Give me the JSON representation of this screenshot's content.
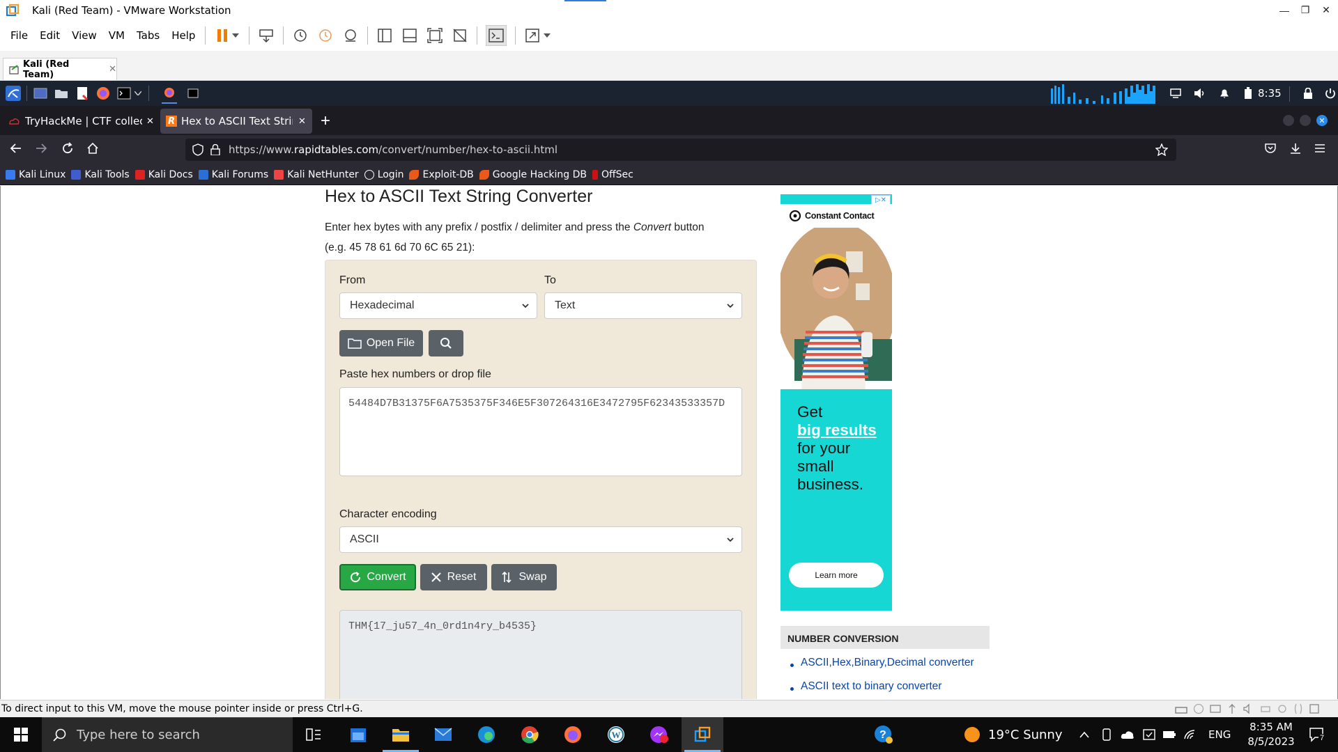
{
  "window": {
    "title": "Kali (Red Team) - VMware Workstation"
  },
  "menu": [
    "File",
    "Edit",
    "View",
    "VM",
    "Tabs",
    "Help"
  ],
  "vm_tab": {
    "label": "Kali (Red Team)"
  },
  "kali_panel": {
    "time": "8:35"
  },
  "browser": {
    "tabs": [
      {
        "label": "TryHackMe | CTF collectio",
        "active": false
      },
      {
        "label": "Hex to ASCII Text String C",
        "active": true
      }
    ],
    "url_prefix": "https://www.",
    "url_domain": "rapidtables.com",
    "url_path": "/convert/number/hex-to-ascii.html",
    "bookmarks": [
      "Kali Linux",
      "Kali Tools",
      "Kali Docs",
      "Kali Forums",
      "Kali NetHunter",
      "Login",
      "Exploit-DB",
      "Google Hacking DB",
      "OffSec"
    ]
  },
  "page": {
    "title": "Hex to ASCII Text String Converter",
    "desc_pre": "Enter hex bytes with any prefix / postfix / delimiter and press the ",
    "desc_em": "Convert",
    "desc_post": " button",
    "desc_example": "(e.g. 45 78 61 6d 70 6C 65 21):",
    "from_label": "From",
    "from_value": "Hexadecimal",
    "to_label": "To",
    "to_value": "Text",
    "open_file": "Open File",
    "paste_label": "Paste hex numbers or drop file",
    "hex_input": "54484D7B31375F6A7535375F346E5F307264316E3472795F62343533357D",
    "encoding_label": "Character encoding",
    "encoding_value": "ASCII",
    "convert": "Convert",
    "reset": "Reset",
    "swap": "Swap",
    "output": "THM{17_ju57_4n_0rd1n4ry_b4535}"
  },
  "ad": {
    "brand": "Constant Contact",
    "line1": "Get",
    "line2": "big results",
    "line3": "for your",
    "line4": "small",
    "line5": "business.",
    "cta": "Learn more"
  },
  "sidebar": {
    "heading": "NUMBER CONVERSION",
    "links": [
      "ASCII,Hex,Binary,Decimal converter",
      "ASCII text to binary converter"
    ]
  },
  "status_bar": {
    "text": "To direct input to this VM, move the mouse pointer inside or press Ctrl+G."
  },
  "taskbar": {
    "search_placeholder": "Type here to search",
    "weather": "19°C  Sunny",
    "lang": "ENG",
    "time": "8:35 AM",
    "date": "8/5/2023",
    "notif_count": "7"
  },
  "colors": {
    "convert_green": "#28a745",
    "btn_grey": "#5a6268",
    "tool_bg": "#f0e8d8",
    "ad_bg": "#17d7d5",
    "link": "#0645ad"
  }
}
